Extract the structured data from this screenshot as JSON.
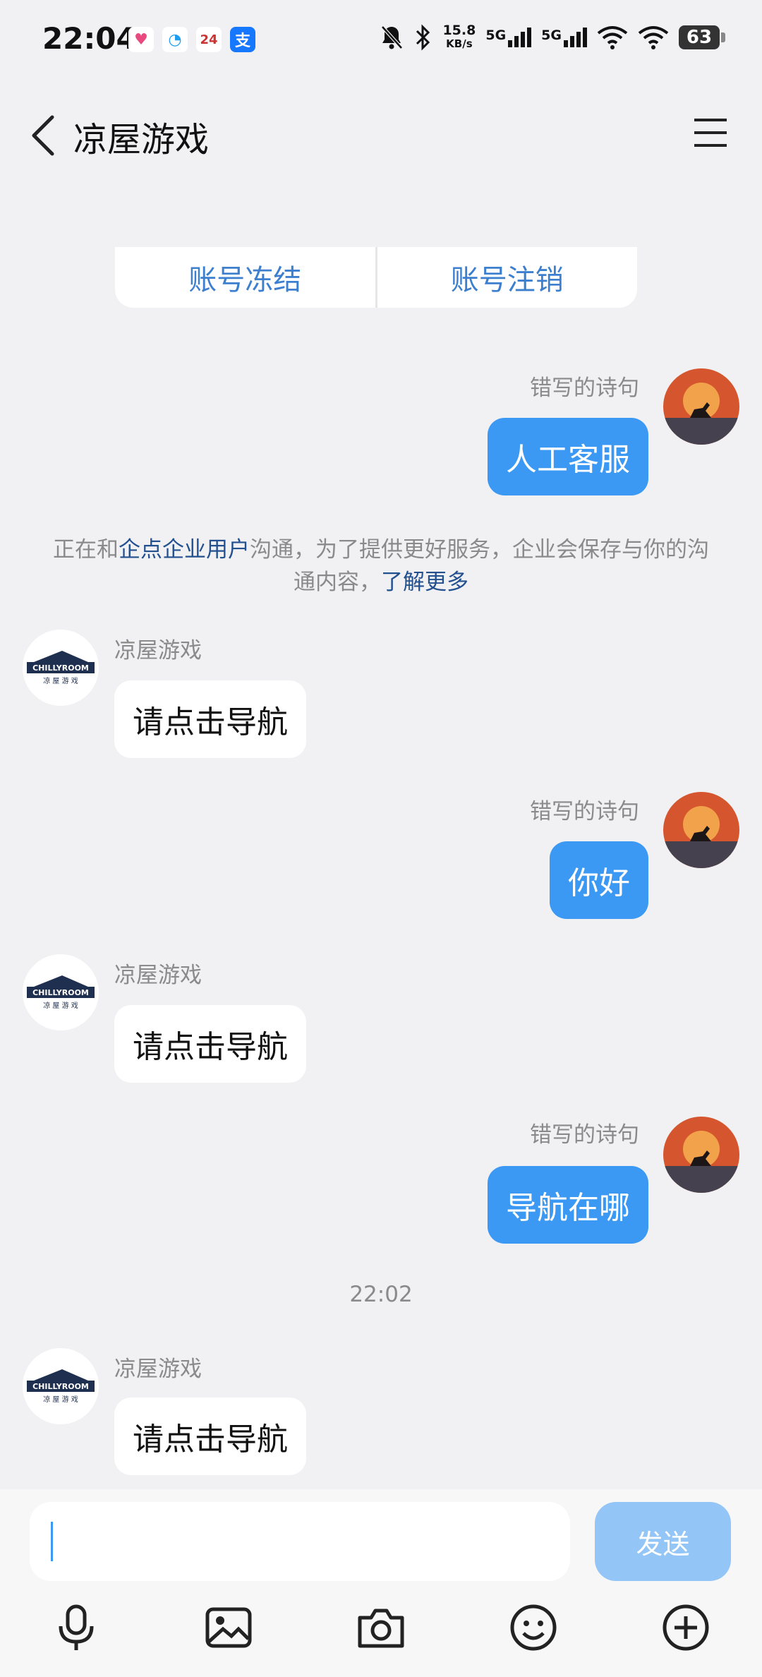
{
  "status_bar": {
    "time": "22:04",
    "net_speed_value": "15.8",
    "net_speed_unit": "KB/s",
    "sim1": "5G",
    "sim2": "5G",
    "battery": "63",
    "notification_icons": [
      "heart-app-icon",
      "chat-app-icon",
      "calendar-24-icon",
      "alipay-icon"
    ],
    "calendar_day": "24",
    "alipay_glyph": "支"
  },
  "header": {
    "title": "凉屋游戏"
  },
  "quick_actions": [
    "账号冻结",
    "账号注销"
  ],
  "notice": {
    "prefix": "正在和",
    "link1": "企点企业用户",
    "middle": "沟通，为了提供更好服务，企业会保存与你的沟通内容，",
    "link2": "了解更多"
  },
  "messages": [
    {
      "side": "right",
      "sender": "错写的诗句",
      "text": "人工客服"
    },
    {
      "side": "left",
      "sender": "凉屋游戏",
      "text": "请点击导航"
    },
    {
      "side": "right",
      "sender": "错写的诗句",
      "text": "你好"
    },
    {
      "side": "left",
      "sender": "凉屋游戏",
      "text": "请点击导航"
    },
    {
      "side": "right",
      "sender": "错写的诗句",
      "text": "导航在哪"
    },
    {
      "side": "left",
      "sender": "凉屋游戏",
      "text": "请点击导航"
    }
  ],
  "timestamp": "22:02",
  "logo": {
    "brand": "CHILLYROOM",
    "subtitle": "凉 屋 游 戏"
  },
  "composer": {
    "send_label": "发送",
    "input_value": ""
  },
  "toolbar_icons": [
    "microphone-icon",
    "image-icon",
    "camera-icon",
    "emoji-icon",
    "plus-icon"
  ],
  "colors": {
    "accent": "#3b99f4",
    "send_disabled": "#93c6f6",
    "link": "#23508f",
    "quick_action": "#3d7fcf"
  }
}
